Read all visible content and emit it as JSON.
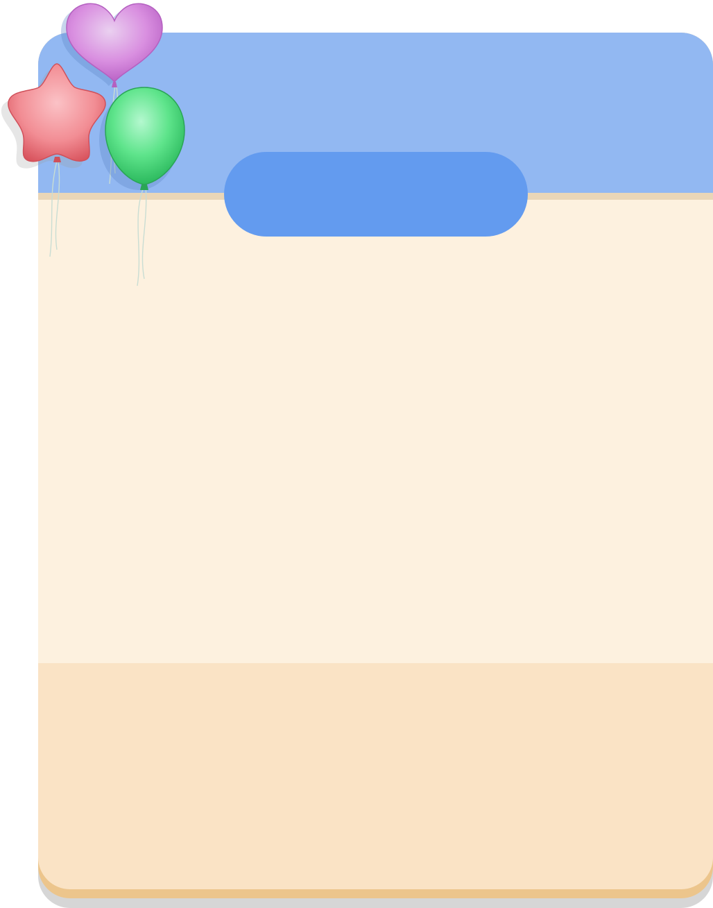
{
  "title_banner": {
    "label": ""
  },
  "decorations": {
    "balloons": [
      {
        "icon": "heart-balloon-icon",
        "color": "#d37fdb"
      },
      {
        "icon": "star-balloon-icon",
        "color": "#f0808a"
      },
      {
        "icon": "round-balloon-icon",
        "color": "#4ee07e"
      }
    ]
  },
  "colors": {
    "header": "#92b8f2",
    "title_pill": "#639bef",
    "body": "#fdf1df",
    "footer": "#fae3c5",
    "panel_edge": "#ecc58c"
  }
}
